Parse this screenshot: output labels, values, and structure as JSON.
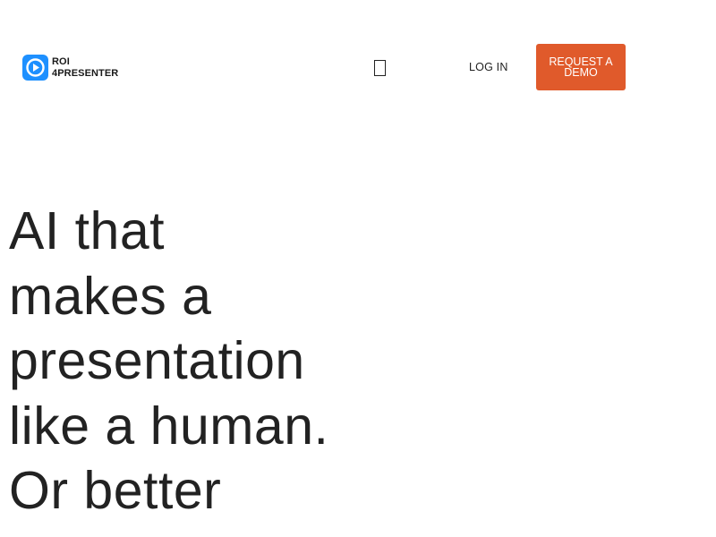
{
  "header": {
    "logo": {
      "line1": "ROI",
      "line2": "4PRESENTER",
      "icon": "play-circle-icon",
      "brand_color": "#1e90ff"
    },
    "menu_icon": "menu-icon",
    "login_label": "LOG IN",
    "demo_button_label": "REQUEST A DEMO",
    "demo_button_color": "#e05a2b"
  },
  "hero": {
    "title_lines": [
      "AI that",
      "makes a",
      "presentation",
      "like a human.",
      "Or better"
    ]
  }
}
